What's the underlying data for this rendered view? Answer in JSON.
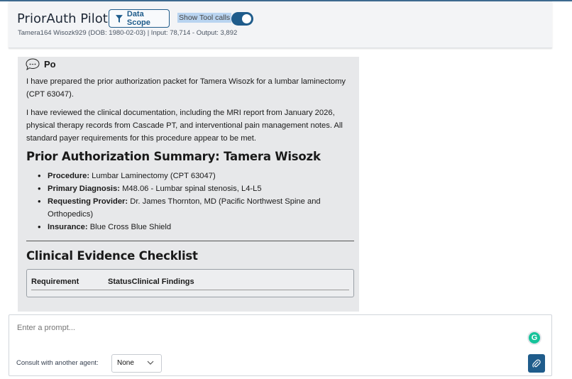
{
  "header": {
    "app_title": "PriorAuth Pilot",
    "data_scope_label": "Data Scope",
    "show_tool_calls_label": "Show Tool calls",
    "show_tool_calls_on": true,
    "patient_line": "Tamera164 Wisozk929 (DOB: 1980-02-03)  | Input: 78,714 - Output: 3,892"
  },
  "message": {
    "agent_name": "Po",
    "para1": "I have prepared the prior authorization packet for Tamera Wisozk for a lumbar laminectomy (CPT 63047).",
    "para2": "I have reviewed the clinical documentation, including the MRI report from January 2026, physical therapy records from Cascade PT, and interventional pain management notes. All standard payer requirements for this procedure appear to be met.",
    "summary_heading": "Prior Authorization Summary: Tamera Wisozk",
    "facts": [
      {
        "label": "Procedure:",
        "value": "Lumbar Laminectomy (CPT 63047)"
      },
      {
        "label": "Primary Diagnosis:",
        "value": "M48.06 - Lumbar spinal stenosis, L4-L5"
      },
      {
        "label": "Requesting Provider:",
        "value": "Dr. James Thornton, MD (Pacific Northwest Spine and Orthopedics)"
      },
      {
        "label": "Insurance:",
        "value": "Blue Cross Blue Shield"
      }
    ],
    "checklist_heading": "Clinical Evidence Checklist",
    "table_headers": [
      "Requirement",
      "Status",
      "Clinical Findings"
    ]
  },
  "prompt": {
    "placeholder": "Enter a prompt...",
    "consult_label": "Consult with another agent:",
    "consult_value": "None"
  },
  "colors": {
    "accent": "#1f5c8b",
    "message_bg": "#e7e8ea",
    "header_bg": "#f3f4f6"
  }
}
